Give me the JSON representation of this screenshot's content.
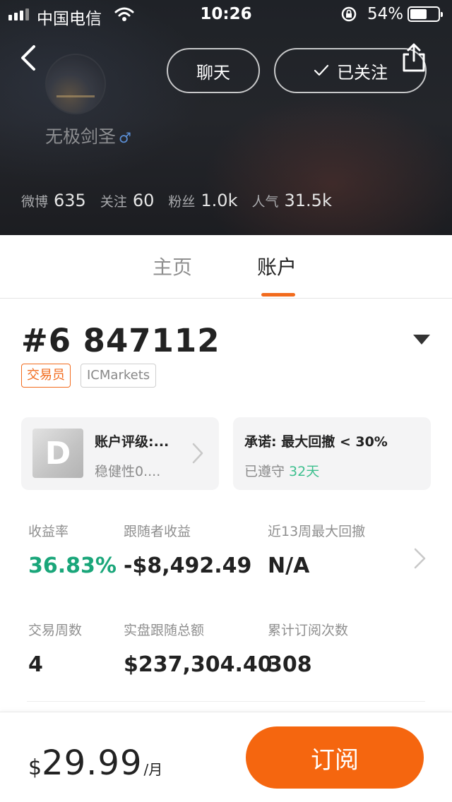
{
  "status_bar": {
    "carrier": "中国电信",
    "time": "10:26",
    "battery_percent": "54%",
    "battery_level": 0.54
  },
  "profile": {
    "username": "无极剑圣",
    "gender_symbol": "♂",
    "chat_label": "聊天",
    "follow_label": "已关注",
    "stats": [
      {
        "label": "微博",
        "value": "635"
      },
      {
        "label": "关注",
        "value": "60"
      },
      {
        "label": "粉丝",
        "value": "1.0k"
      },
      {
        "label": "人气",
        "value": "31.5k"
      }
    ]
  },
  "tabs": {
    "home": "主页",
    "account": "账户"
  },
  "account": {
    "id": "#6 847112",
    "tags": [
      "交易员",
      "ICMarkets"
    ],
    "rating": {
      "grade": "D",
      "title": "账户评级:...",
      "subtitle": "稳健性0...."
    },
    "promise": {
      "title": "承诺: 最大回撤 < 30%",
      "subtitle_prefix": "已遵守 ",
      "days": "32天"
    },
    "metrics": [
      {
        "label": "收益率",
        "value": "36.83%"
      },
      {
        "label": "跟随者收益",
        "value": "-$8,492.49"
      },
      {
        "label": "近13周最大回撤",
        "value": "N/A"
      },
      {
        "label": "交易周数",
        "value": "4"
      },
      {
        "label": "实盘跟随总额",
        "value": "$237,304.40"
      },
      {
        "label": "累计订阅次数",
        "value": "308"
      }
    ]
  },
  "subscription": {
    "currency": "$",
    "amount": "29.99",
    "unit": "/月",
    "button_label": "订阅"
  },
  "colors": {
    "accent_orange": "#f5660f",
    "positive_green": "#1aa67a",
    "header_dark": "#222429"
  }
}
